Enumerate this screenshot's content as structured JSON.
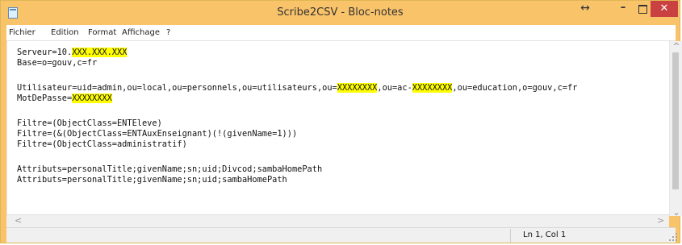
{
  "window": {
    "title": "Scribe2CSV - Bloc-notes"
  },
  "titlebar": {
    "resize": "↔",
    "minimize": "–",
    "close": "✕"
  },
  "menu": [
    "Fichier",
    "Edition",
    "Format",
    "Affichage",
    "?"
  ],
  "editor": {
    "lines": [
      [
        {
          "t": "Serveur=10."
        },
        {
          "t": "XXX.XXX.XXX",
          "hl": true
        }
      ],
      [
        {
          "t": "Base=o=gouv,c=fr"
        }
      ],
      [],
      [
        {
          "t": "Utilisateur=uid=admin,ou=local,ou=personnels,ou=utilisateurs,ou="
        },
        {
          "t": "XXXXXXXX",
          "hl": true
        },
        {
          "t": ",ou=ac-"
        },
        {
          "t": "XXXXXXXX",
          "hl": true
        },
        {
          "t": ",ou=education,o=gouv,c=fr"
        }
      ],
      [
        {
          "t": "MotDePasse="
        },
        {
          "t": "XXXXXXXX",
          "hl": true
        }
      ],
      [],
      [
        {
          "t": "Filtre=(ObjectClass=ENTEleve)"
        }
      ],
      [
        {
          "t": "Filtre=(&(ObjectClass=ENTAuxEnseignant)(!(givenName=1)))"
        }
      ],
      [
        {
          "t": "Filtre=(ObjectClass=administratif)"
        }
      ],
      [],
      [
        {
          "t": "Attributs=personalTitle;givenName;sn;uid;Divcod;sambaHomePath"
        }
      ],
      [
        {
          "t": "Attributs=personalTitle;givenName;sn;uid;sambaHomePath"
        }
      ]
    ]
  },
  "status": {
    "cursor": "Ln 1, Col 1"
  },
  "colors": {
    "titlebar": "#f9c36a",
    "close": "#c94141",
    "highlight": "#ffff00"
  }
}
